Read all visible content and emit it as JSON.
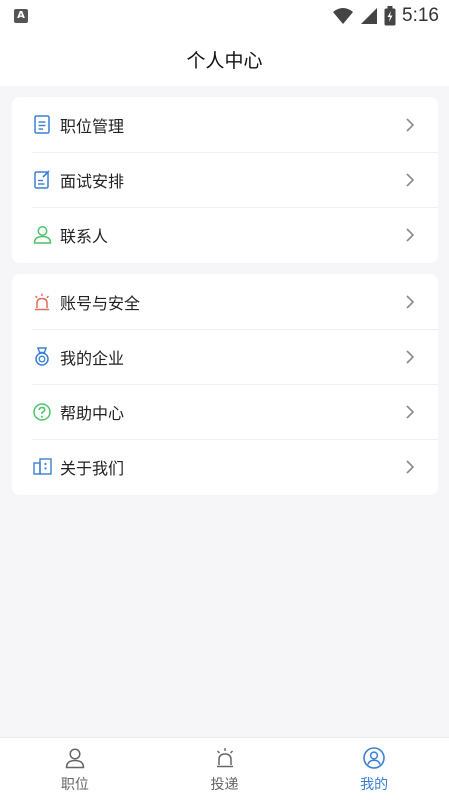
{
  "status_bar": {
    "notification_label": "A",
    "time": "5:16"
  },
  "header": {
    "title": "个人中心"
  },
  "menu_group_1": [
    {
      "label": "职位管理",
      "icon": "document-list-icon"
    },
    {
      "label": "面试安排",
      "icon": "note-edit-icon"
    },
    {
      "label": "联系人",
      "icon": "contact-person-icon"
    }
  ],
  "menu_group_2": [
    {
      "label": "账号与安全",
      "icon": "alarm-light-icon"
    },
    {
      "label": "我的企业",
      "icon": "medal-icon"
    },
    {
      "label": "帮助中心",
      "icon": "help-circle-icon"
    },
    {
      "label": "关于我们",
      "icon": "info-panel-icon"
    }
  ],
  "tabbar": {
    "items": [
      {
        "label": "职位",
        "icon": "person-icon",
        "active": false
      },
      {
        "label": "投递",
        "icon": "alarm-light-icon",
        "active": false
      },
      {
        "label": "我的",
        "icon": "user-circle-icon",
        "active": true
      }
    ]
  },
  "colors": {
    "accent": "#3b7fd6",
    "green": "#4cc46a",
    "red": "#e56a5a",
    "background": "#f6f6f9"
  }
}
